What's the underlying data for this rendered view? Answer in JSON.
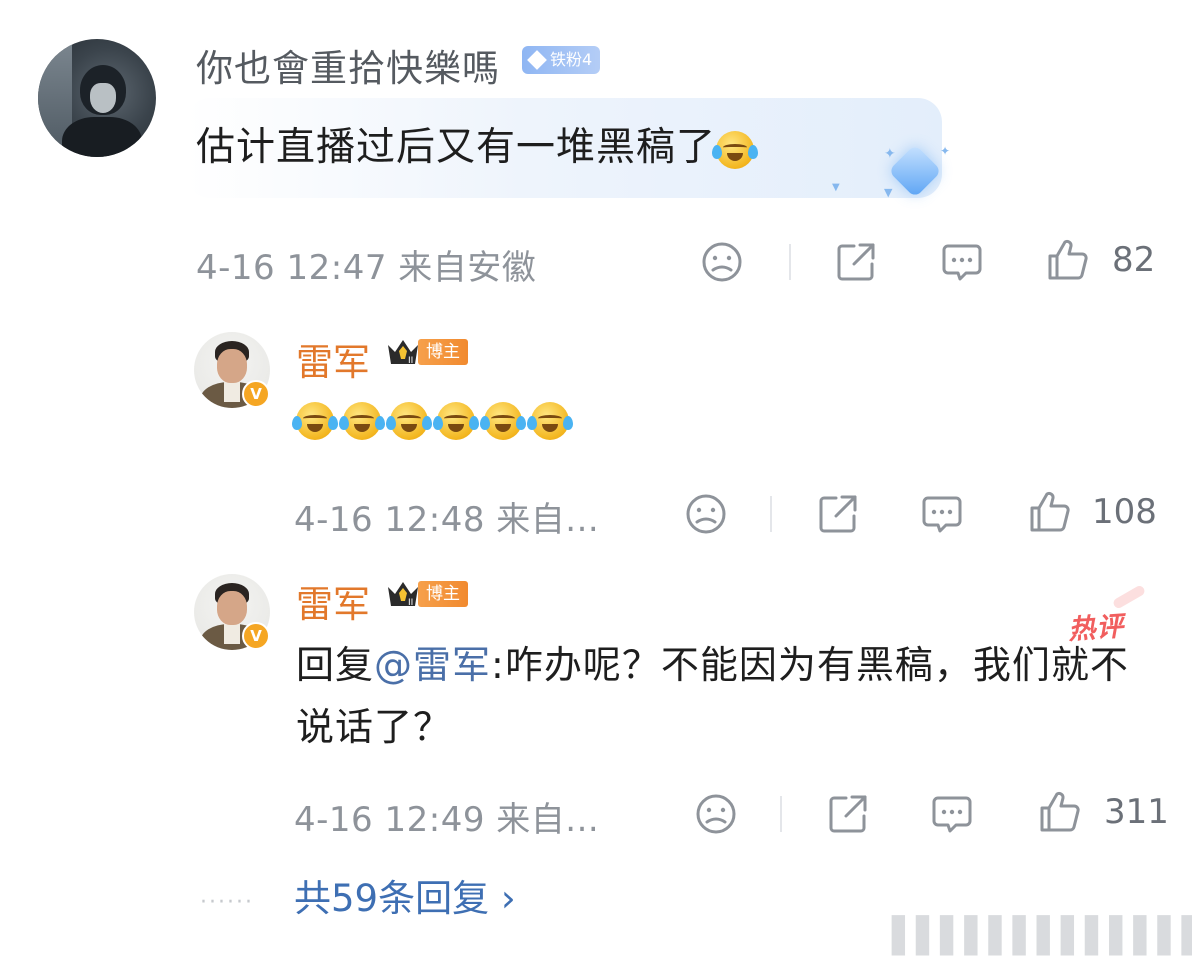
{
  "main_comment": {
    "username": "你也會重拾快樂嗎",
    "fan_badge": "铁粉4",
    "text": "估计直播过后又有一堆黑稿了",
    "emoji": "laugh-cry-emoji",
    "date": "4-16 12:47",
    "location": "来自安徽",
    "likes": "82"
  },
  "replies": [
    {
      "username": "雷军",
      "role_badge": "博主",
      "text_emojis": [
        "laugh-cry-emoji",
        "laugh-cry-emoji",
        "laugh-cry-emoji",
        "laugh-cry-emoji",
        "laugh-cry-emoji",
        "laugh-cry-emoji"
      ],
      "date": "4-16 12:48",
      "location": "来自...",
      "likes": "108",
      "verified_mark": "V"
    },
    {
      "username": "雷军",
      "role_badge": "博主",
      "reply_prefix": "回复",
      "mention": "@雷军",
      "text": ":咋办呢？不能因为有黑稿，我们就不说话了？",
      "hot_label": "热评",
      "date": "4-16 12:49",
      "location": "来自...",
      "likes": "311",
      "verified_mark": "V"
    }
  ],
  "more_replies": "共59条回复 ›",
  "colors": {
    "username_gray": "#555a60",
    "blogger_orange": "#e2782b",
    "link_blue": "#3e6fb3",
    "meta_gray": "#8e939a",
    "hot_red": "#f04d4d"
  }
}
